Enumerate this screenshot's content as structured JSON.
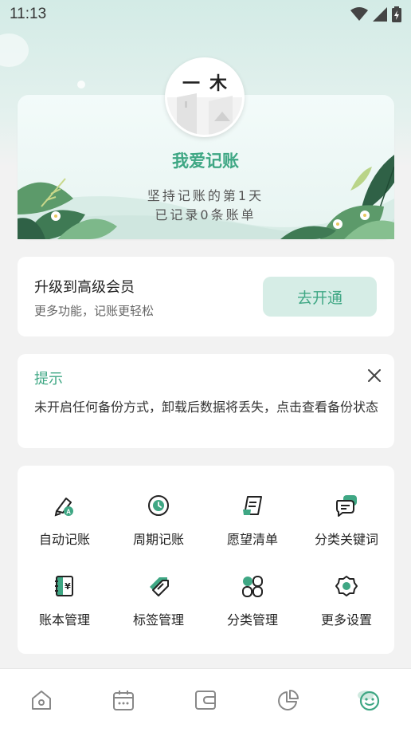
{
  "status_bar": {
    "time": "11:13"
  },
  "profile": {
    "avatar_text": "一木",
    "name": "我爱记账",
    "days_line": "坚持记账的第1天",
    "records_line": "已记录0条账单"
  },
  "member": {
    "title": "升级到高级会员",
    "subtitle": "更多功能，记账更轻松",
    "button": "去开通"
  },
  "tip": {
    "title": "提示",
    "body": "未开启任何备份方式，卸载后数据将丢失，点击查看备份状态"
  },
  "features": [
    {
      "label": "自动记账",
      "icon": "auto-bookkeeping-icon"
    },
    {
      "label": "周期记账",
      "icon": "periodic-bookkeeping-icon"
    },
    {
      "label": "愿望清单",
      "icon": "wishlist-icon"
    },
    {
      "label": "分类关键词",
      "icon": "category-keyword-icon"
    },
    {
      "label": "账本管理",
      "icon": "ledger-icon"
    },
    {
      "label": "标签管理",
      "icon": "tag-icon"
    },
    {
      "label": "分类管理",
      "icon": "category-icon"
    },
    {
      "label": "更多设置",
      "icon": "settings-icon"
    }
  ],
  "nav": [
    "home-icon",
    "calendar-icon",
    "wallet-icon",
    "chart-icon",
    "profile-icon"
  ],
  "colors": {
    "accent": "#3fa784",
    "accent_light": "#d6ede6",
    "background": "#f2f2f2"
  }
}
